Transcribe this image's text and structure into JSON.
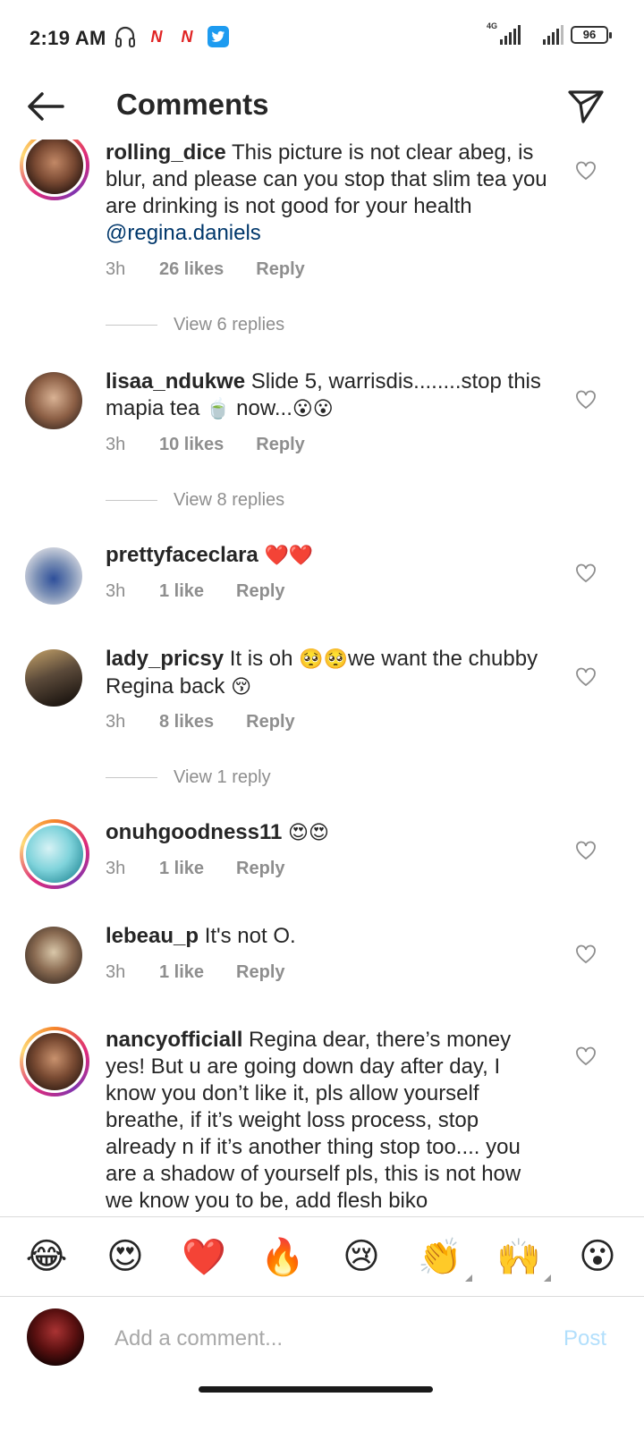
{
  "status_bar": {
    "time": "2:19 AM",
    "network": "4G",
    "battery": "96"
  },
  "header": {
    "title": "Comments"
  },
  "comments": [
    {
      "username": "rolling_dice",
      "text": "This picture is not clear abeg, is blur, and please can you stop that slim tea you are drinking is not good for your health",
      "mention": "@regina.daniels",
      "time": "3h",
      "likes": "26 likes",
      "reply": "Reply",
      "view_replies": "View 6 replies"
    },
    {
      "username": "lisaa_ndukwe",
      "text": "Slide 5, warrisdis........stop this mapia tea",
      "text_emoji_1": "🍵",
      "text_after": "now...",
      "text_emoji_2": "😮😮",
      "time": "3h",
      "likes": "10 likes",
      "reply": "Reply",
      "view_replies": "View 8 replies"
    },
    {
      "username": "prettyfaceclara",
      "text_emoji": "❤️❤️",
      "time": "3h",
      "likes": "1 like",
      "reply": "Reply"
    },
    {
      "username": "lady_pricsy",
      "text": "It is oh",
      "text_emoji_1": "🥺🥺",
      "text_after": "we want the chubby Regina back",
      "text_emoji_2": "😚",
      "time": "3h",
      "likes": "8 likes",
      "reply": "Reply",
      "view_replies": "View 1 reply"
    },
    {
      "username": "onuhgoodness11",
      "text_emoji": "😍😍",
      "time": "3h",
      "likes": "1 like",
      "reply": "Reply"
    },
    {
      "username": "lebeau_p",
      "text": "It's not O.",
      "time": "3h",
      "likes": "1 like",
      "reply": "Reply"
    },
    {
      "username": "nancyofficiall",
      "text": "Regina dear, there’s money yes! But u are going down day after day, I know you don’t like it, pls allow yourself breathe, if it’s weight loss process, stop already n if it’s another thing stop too.... you are a shadow of yourself pls, this is not how we know you to be, add flesh biko"
    }
  ],
  "emoji_bar": [
    "😂",
    "😍",
    "❤️",
    "🔥",
    "😢",
    "👏",
    "🙌",
    "😮"
  ],
  "composer": {
    "placeholder": "Add a comment...",
    "post_label": "Post"
  },
  "colors": {
    "mention": "#00376b",
    "meta_gray": "#8e8e8e",
    "post_disabled": "#b2dffc",
    "story_ring": "#dd2a7b"
  }
}
